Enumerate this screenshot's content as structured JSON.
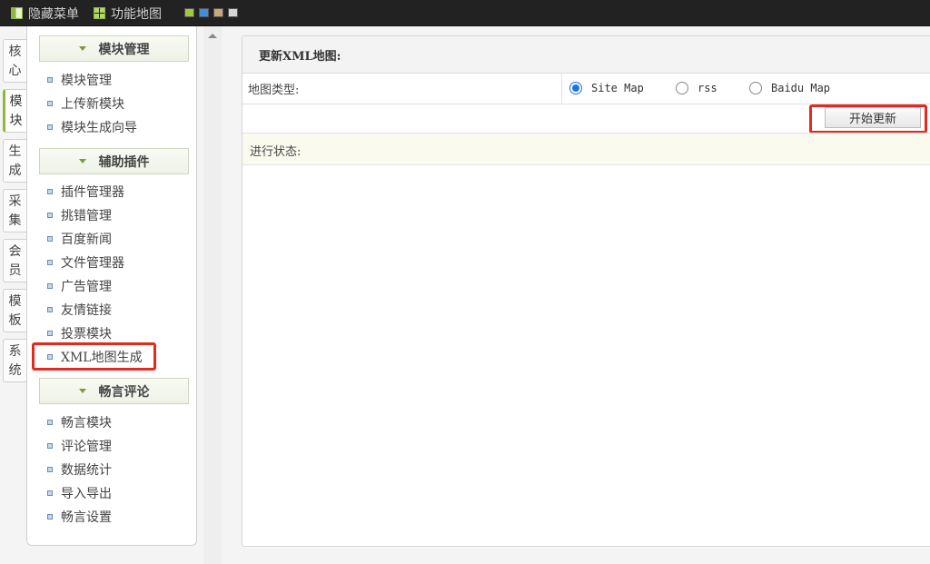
{
  "topbar": {
    "hide_menu": "隐藏菜单",
    "function_map": "功能地图",
    "theme_colors": [
      "#9ccc3c",
      "#3f8fd8",
      "#c8a77a",
      "#d7d7d7"
    ]
  },
  "vtabs": [
    {
      "label": "核心",
      "active": false
    },
    {
      "label": "模块",
      "active": true
    },
    {
      "label": "生成",
      "active": false
    },
    {
      "label": "采集",
      "active": false
    },
    {
      "label": "会员",
      "active": false
    },
    {
      "label": "模板",
      "active": false
    },
    {
      "label": "系统",
      "active": false
    }
  ],
  "sidebar": {
    "sections": [
      {
        "title": "模块管理",
        "items": [
          "模块管理",
          "上传新模块",
          "模块生成向导"
        ]
      },
      {
        "title": "辅助插件",
        "items": [
          "插件管理器",
          "挑错管理",
          "百度新闻",
          "文件管理器",
          "广告管理",
          "友情链接",
          "投票模块",
          "XML地图生成"
        ]
      },
      {
        "title": "畅言评论",
        "items": [
          "畅言模块",
          "评论管理",
          "数据统计",
          "导入导出",
          "畅言设置"
        ]
      }
    ],
    "highlighted_item": "XML地图生成"
  },
  "main": {
    "title": "更新XML地图:",
    "map_type_label": "地图类型:",
    "map_types": [
      {
        "label": "Site Map",
        "checked": true
      },
      {
        "label": "rss",
        "checked": false
      },
      {
        "label": "Baidu Map",
        "checked": false
      }
    ],
    "start_button": "开始更新",
    "status_label": "进行状态:"
  }
}
